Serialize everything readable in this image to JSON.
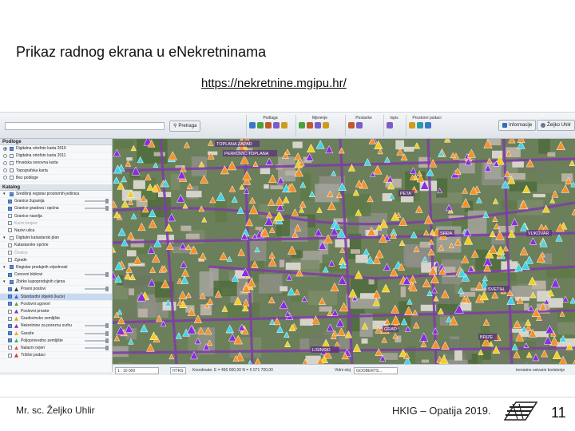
{
  "slide": {
    "title": "Prikaz radnog ekrana u eNekretninama",
    "link": "https://nekretnine.mgipu.hr/",
    "footer": {
      "author": "Mr. sc. Željko Uhlir",
      "event": "HKIG – Opatija 2019.",
      "page_number": "11"
    }
  },
  "app": {
    "search": {
      "button_label": "Pretraga",
      "value": ""
    },
    "toolbar_groups": [
      {
        "label": "Podlaga",
        "icon_count": 5
      },
      {
        "label": "Mjerenje",
        "icon_count": 4
      },
      {
        "label": "Postavke",
        "icon_count": 2
      },
      {
        "label": "Ispis",
        "icon_count": 1
      },
      {
        "label": "Prostorni podaci",
        "icon_count": 3
      }
    ],
    "info_button": "Informacije",
    "user_button": "Željko Uhlir",
    "basemaps_header": "Podloge",
    "basemaps": [
      {
        "label": "Digitalna ortofoto karta 2016",
        "selected": true
      },
      {
        "label": "Digitalna ortofoto karta 2011",
        "selected": false
      },
      {
        "label": "Hrvatska osnovna karta",
        "selected": false
      },
      {
        "label": "Topografska karta",
        "selected": false
      },
      {
        "label": "Bez podloge",
        "selected": false
      }
    ],
    "catalog_header": "Katalog",
    "catalog": [
      {
        "label": "Središnji registar prostornih jedinica",
        "kind": "group",
        "checked": true
      },
      {
        "label": "Granice županija",
        "kind": "layer",
        "checked": true,
        "slider": true,
        "swatch": ""
      },
      {
        "label": "Granice gradova i općina",
        "kind": "layer",
        "checked": true,
        "slider": true,
        "swatch": ""
      },
      {
        "label": "Granice naselja",
        "kind": "layer",
        "checked": false,
        "slider": false,
        "swatch": ""
      },
      {
        "label": "Kućni brojevi",
        "kind": "layer",
        "checked": false,
        "slider": false,
        "dim": true,
        "swatch": ""
      },
      {
        "label": "Nazivi ulica",
        "kind": "layer",
        "checked": false,
        "slider": false,
        "swatch": ""
      },
      {
        "label": "Digitalni katastarski plan",
        "kind": "group",
        "checked": false
      },
      {
        "label": "Katastarske općine",
        "kind": "layer",
        "checked": false,
        "slider": false,
        "swatch": ""
      },
      {
        "label": "Čestice",
        "kind": "layer",
        "checked": false,
        "slider": false,
        "dim": true,
        "swatch": ""
      },
      {
        "label": "Zgrade",
        "kind": "layer",
        "checked": false,
        "slider": false,
        "swatch": ""
      },
      {
        "label": "Registar prodajnih vrijednosti",
        "kind": "group",
        "checked": true
      },
      {
        "label": "Cenovni blokovi",
        "kind": "layer",
        "checked": true,
        "slider": true,
        "swatch": ""
      },
      {
        "label": "Zbirke kupoprodajnih cijena",
        "kind": "group",
        "checked": true
      },
      {
        "label": "Pravni poslovi",
        "kind": "layer",
        "checked": true,
        "slider": true,
        "swatch": "#3b3b3b"
      },
      {
        "label": "Standardni objekti (kuće)",
        "kind": "layer",
        "checked": true,
        "slider": false,
        "selected": true,
        "swatch": "#2d6bd8"
      },
      {
        "label": "Poslovni ugovori",
        "kind": "layer",
        "checked": true,
        "slider": false,
        "swatch": "#5e9f34"
      },
      {
        "label": "Poslovni prostor",
        "kind": "layer",
        "checked": false,
        "slider": false,
        "swatch": "#7c3aa8"
      },
      {
        "label": "Građevinsko zemljište",
        "kind": "layer",
        "checked": false,
        "slider": false,
        "swatch": "#c7b400"
      },
      {
        "label": "Nekretnine za poreznu svrhu",
        "kind": "layer",
        "checked": true,
        "slider": true,
        "swatch": "#9a2ab5"
      },
      {
        "label": "Garaže",
        "kind": "layer",
        "checked": true,
        "slider": true,
        "swatch": "#f5a623"
      },
      {
        "label": "Poljoprivredno zemljište",
        "kind": "layer",
        "checked": true,
        "slider": true,
        "swatch": "#32b34a"
      },
      {
        "label": "Nalazni ovjeri",
        "kind": "layer",
        "checked": false,
        "slider": true,
        "swatch": "#d94b2b"
      },
      {
        "label": "Tržišni podaci",
        "kind": "layer",
        "checked": false,
        "slider": false,
        "swatch": "#e0342f"
      }
    ],
    "map_labels": [
      "TOPLANA ZAPAD",
      "PERKOVIĆ TOPLANA",
      "PETA",
      "SRĐA",
      "SVETIH",
      "GRAD",
      "LISINSKI",
      "BRIZE",
      "VUKOVAR"
    ],
    "status": {
      "scale": "1 : 10 000",
      "projection": "HTRS",
      "coordinates": "Koordinate: E = 456 000,00 N = 5 071 700,00",
      "view_label": "Vidni sloj",
      "view_value": "GOOBERTS...",
      "footer_note": "treniutno ostvarin koristenje"
    },
    "colors": {
      "orange_pin": "#f5922a",
      "cyan_pin": "#42d4e6",
      "purple_pin": "#8a2be2",
      "yellow_pin": "#f2cf1e",
      "road": "#7d3fa3"
    }
  }
}
